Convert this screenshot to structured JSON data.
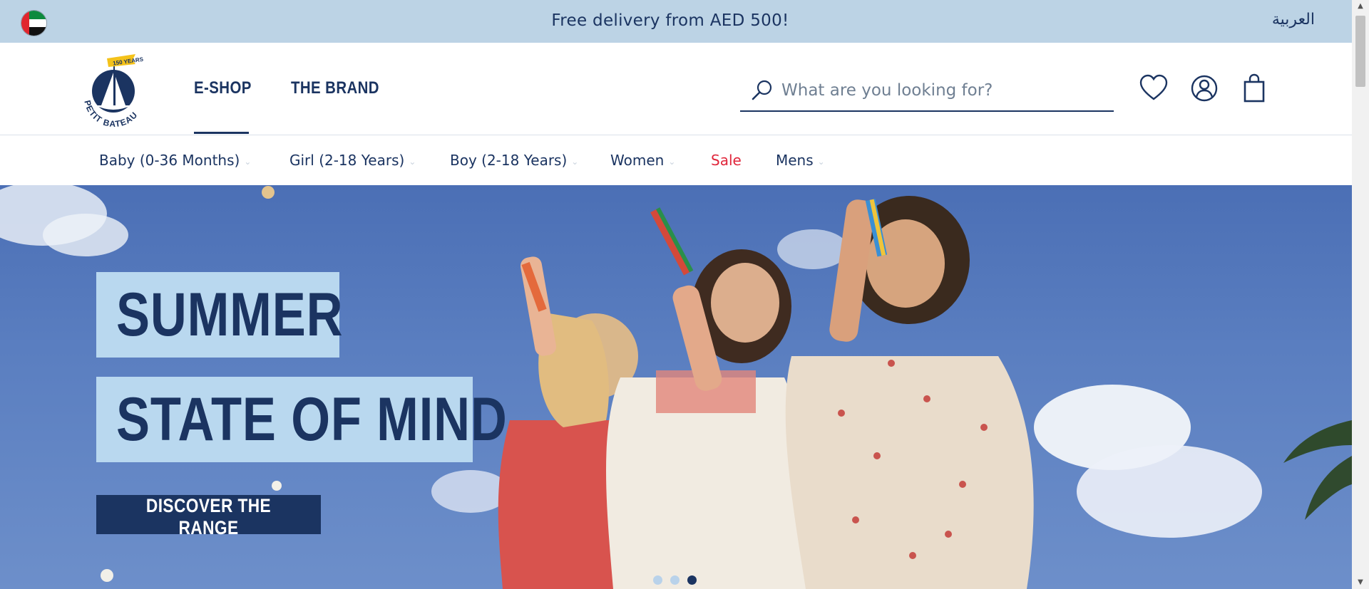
{
  "topbar": {
    "promo": "Free delivery from AED 500!",
    "language": "العربية"
  },
  "header": {
    "logo_text": "PETIT BATEAU",
    "logo_badge": "150 YEARS",
    "nav": [
      {
        "label": "E-SHOP",
        "active": true
      },
      {
        "label": "THE BRAND",
        "active": false
      }
    ],
    "search": {
      "placeholder": "What are you looking for?",
      "value": ""
    }
  },
  "categories": [
    {
      "label": "Baby (0-36 Months)"
    },
    {
      "label": "Girl (2-18 Years)"
    },
    {
      "label": "Boy (2-18 Years)"
    },
    {
      "label": "Women"
    },
    {
      "label": "Sale"
    },
    {
      "label": "Mens"
    }
  ],
  "hero": {
    "line1": "SUMMER",
    "line2": "STATE OF MIND",
    "cta": "DISCOVER THE RANGE",
    "slides": 3,
    "active_slide": 3
  },
  "colors": {
    "navy": "#1b3461",
    "topbar_bg": "#bcd3e5",
    "sale_red": "#e0263b",
    "hero_box": "#b9d8ef"
  }
}
